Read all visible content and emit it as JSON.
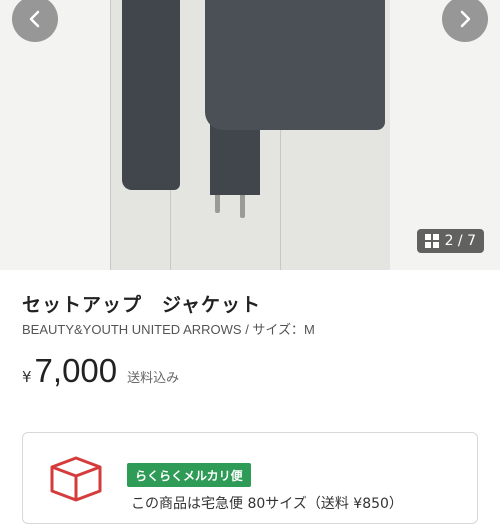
{
  "gallery": {
    "image_counter": "2 / 7",
    "counter_icon": "grid-icon",
    "prev_icon": "chevron-left-icon",
    "next_icon": "chevron-right-icon"
  },
  "product": {
    "title": "セットアップ　ジャケット",
    "brand_size": "BEAUTY&YOUTH UNITED ARROWS / サイズ：M",
    "currency": "¥",
    "price": "7,000",
    "tax_note": "送料込み"
  },
  "shipping": {
    "badge": "らくらくメルカリ便",
    "note": "この商品は宅急便 80サイズ（送料 ¥850）",
    "icon": "package-box-icon",
    "badge_color": "#2e9b57",
    "icon_color": "#d63b3b"
  }
}
